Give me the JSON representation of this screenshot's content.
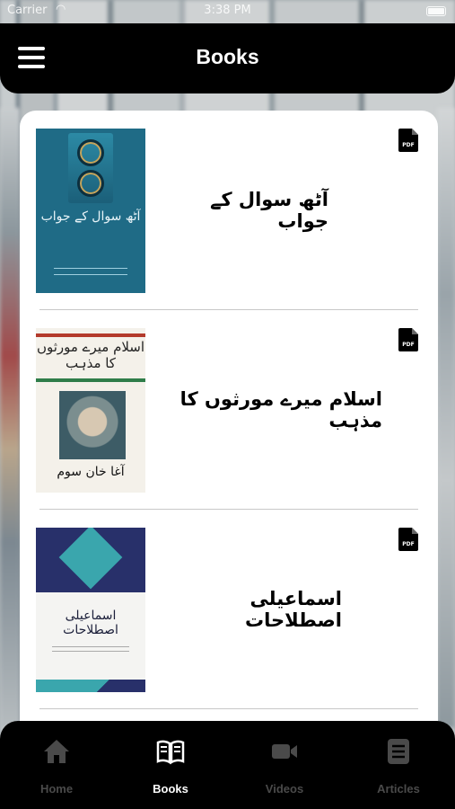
{
  "status_bar": {
    "carrier": "Carrier",
    "time": "3:38 PM"
  },
  "header": {
    "title": "Books"
  },
  "books": [
    {
      "title": "آٹھ سوال کے جواب",
      "cover_text": "آٹھ سوال کے جواب",
      "pdf_icon": "pdf-file-icon"
    },
    {
      "title": "اسلام میرے مورثوں کا مذہب",
      "cover_text_top": "اسلام میرے مورثوں کا مذہب",
      "cover_text_bottom": "آغا خان سوم",
      "pdf_icon": "pdf-file-icon"
    },
    {
      "title": "اسماعیلی اصطلاحات",
      "cover_text": "اسماعیلی اصطلاحات",
      "pdf_icon": "pdf-file-icon"
    }
  ],
  "tabs": [
    {
      "label": "Home",
      "icon": "home-icon",
      "active": false
    },
    {
      "label": "Books",
      "icon": "book-open-icon",
      "active": true
    },
    {
      "label": "Videos",
      "icon": "video-camera-icon",
      "active": false
    },
    {
      "label": "Articles",
      "icon": "article-icon",
      "active": false
    }
  ],
  "colors": {
    "bar_bg": "#000000",
    "active_tab": "#ffffff",
    "inactive_tab": "#4a4a4a",
    "card_bg": "#ffffff"
  }
}
